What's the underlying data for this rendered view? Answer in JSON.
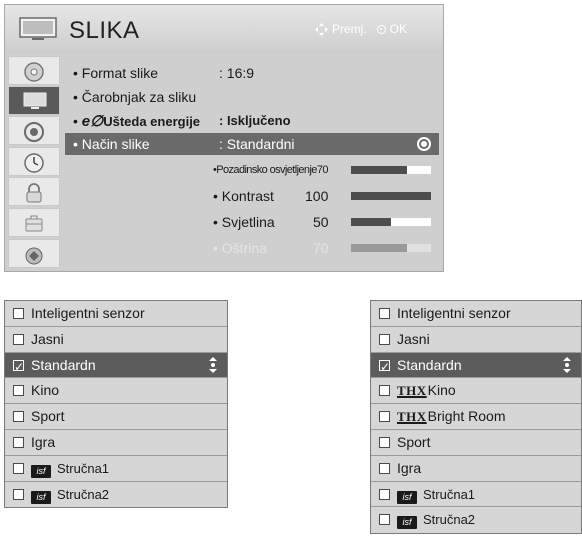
{
  "header": {
    "title": "SLIKA",
    "hint_move": "Premj.",
    "hint_ok": "OK"
  },
  "side_icons": [
    "disc-icon",
    "tv-icon",
    "speaker-icon",
    "clock-icon",
    "lock-icon",
    "settings-case-icon",
    "usb-icon"
  ],
  "menu": {
    "rows": [
      {
        "label": "Format slike",
        "value": ": 16:9"
      },
      {
        "label": "Čarobnjak za sliku",
        "value": ""
      },
      {
        "label": "Ušteda energije",
        "value": ": Isključeno",
        "eco": "e∅"
      },
      {
        "label": "Način slike",
        "value": ": Standardni",
        "selected": true
      }
    ],
    "sliders": [
      {
        "label": "Pozadinsko osvjetljenje",
        "value": "70",
        "level": 0.7
      },
      {
        "label": "Kontrast",
        "value": "100",
        "level": 1.0
      },
      {
        "label": "Svjetlina",
        "value": "50",
        "level": 0.5
      },
      {
        "label": "Oštrina",
        "value": "70",
        "level": 0.7,
        "dimmed": true
      }
    ]
  },
  "list_left": {
    "items": [
      {
        "label": "Inteligentni senzor"
      },
      {
        "label": "Jasni"
      },
      {
        "label": "Standardn",
        "selected": true
      },
      {
        "label": "Kino"
      },
      {
        "label": "Sport"
      },
      {
        "label": "Igra"
      },
      {
        "label": "Stručna1",
        "isf": "isf"
      },
      {
        "label": "Stručna2",
        "isf": "isf"
      }
    ]
  },
  "list_right": {
    "items": [
      {
        "label": "Inteligentni senzor"
      },
      {
        "label": "Jasni"
      },
      {
        "label": "Standardn",
        "selected": true
      },
      {
        "label": "Kino",
        "thx": "THX"
      },
      {
        "label": "Bright Room",
        "thx": "THX"
      },
      {
        "label": "Sport"
      },
      {
        "label": "Igra"
      },
      {
        "label": "Stručna1",
        "isf": "isf"
      },
      {
        "label": "Stručna2",
        "isf": "isf"
      }
    ]
  }
}
